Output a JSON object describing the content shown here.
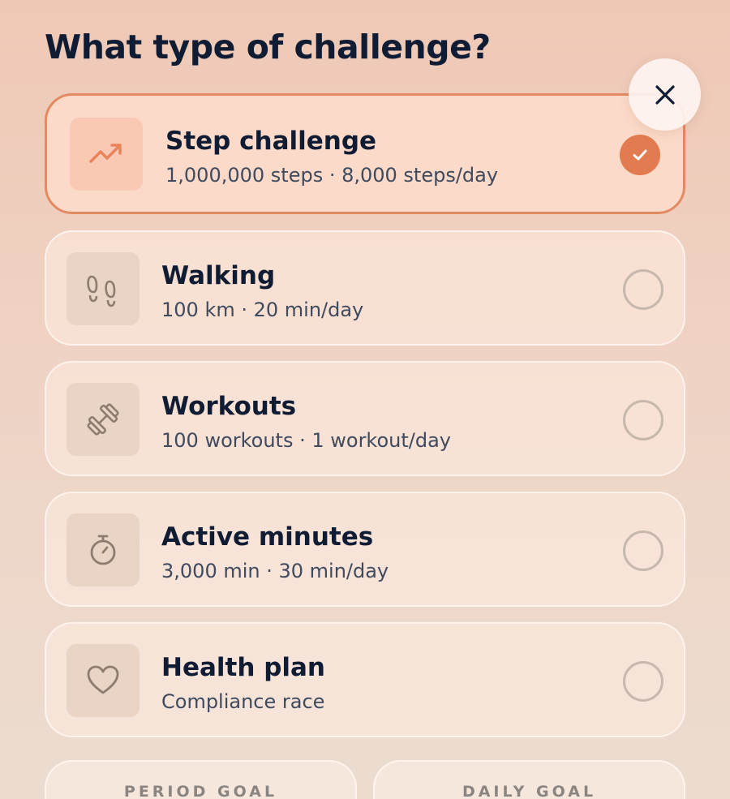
{
  "header": {
    "title": "What type of challenge?"
  },
  "close": {
    "icon": "close-icon"
  },
  "options": [
    {
      "title": "Step challenge",
      "subtitle": "1,000,000 steps · 8,000 steps/day",
      "icon": "trending-up-icon",
      "selected": true
    },
    {
      "title": "Walking",
      "subtitle": "100 km · 20 min/day",
      "icon": "footprints-icon",
      "selected": false
    },
    {
      "title": "Workouts",
      "subtitle": "100 workouts · 1 workout/day",
      "icon": "dumbbell-icon",
      "selected": false
    },
    {
      "title": "Active minutes",
      "subtitle": "3,000 min · 30 min/day",
      "icon": "stopwatch-icon",
      "selected": false
    },
    {
      "title": "Health plan",
      "subtitle": "Compliance race",
      "icon": "heart-icon",
      "selected": false
    }
  ],
  "goals": {
    "period_label": "PERIOD GOAL",
    "daily_label": "DAILY GOAL"
  },
  "colors": {
    "accent": "#e27b4f",
    "selected_border": "#e48a62",
    "title_text": "#101c33",
    "subtitle_text": "#3f4a5e"
  }
}
